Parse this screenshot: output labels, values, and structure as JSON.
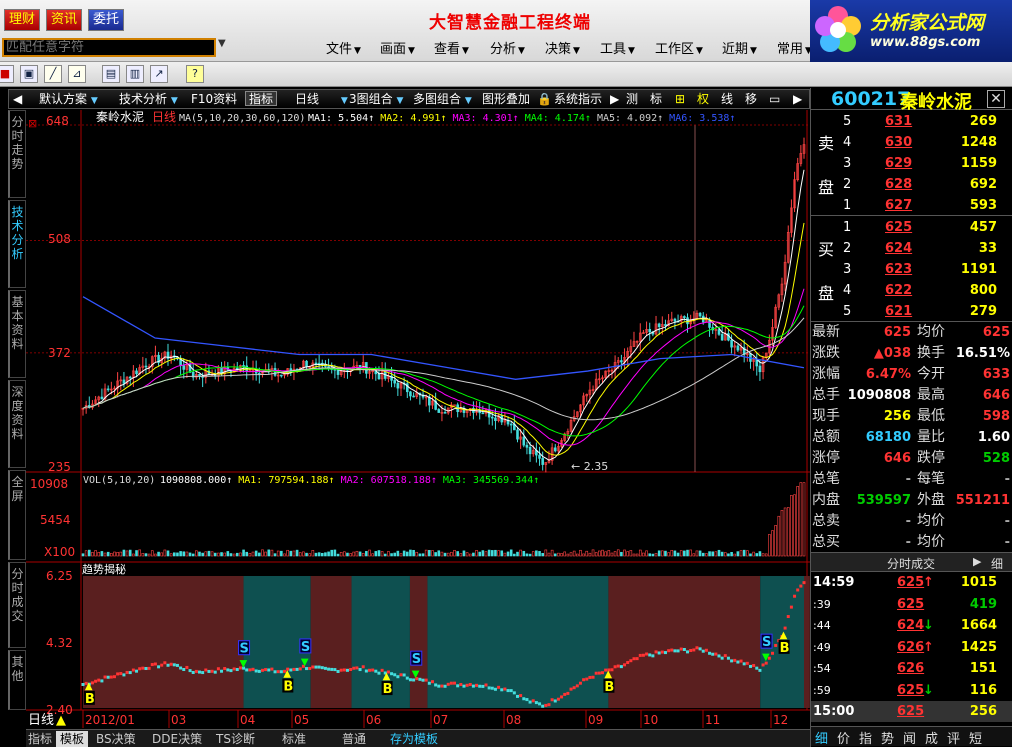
{
  "top": {
    "buttons": [
      "理财",
      "资讯",
      "委托"
    ],
    "title": "大智慧金融工程终端",
    "search_placeholder": "匹配任意字符",
    "menus": [
      "文件",
      "画面",
      "查看",
      "分析",
      "决策",
      "工具",
      "工作区",
      "近期",
      "常用"
    ],
    "logo_text": "分析家公式网",
    "logo_url": "www.88gs.com"
  },
  "toolbar": {
    "items": [
      "默认方案",
      "技术分析",
      "F10资料",
      "指标",
      "日线",
      "3图组合",
      "多图组合",
      "图形叠加",
      "系统指示",
      "测",
      "标",
      "权",
      "线",
      "移"
    ]
  },
  "lefttabs": [
    "分时走势",
    "技术分析",
    "基本资料",
    "深度资料",
    "全屏",
    "分时成交",
    "其他"
  ],
  "chart": {
    "stock_name": "秦岭水泥",
    "period": "日线",
    "ma_label": "MA(5,10,20,30,60,120)",
    "ma_values": [
      {
        "name": "MA1",
        "value": "5.504",
        "color": "#ffffff"
      },
      {
        "name": "MA2",
        "value": "4.991",
        "color": "#ffff00"
      },
      {
        "name": "MA3",
        "value": "4.301",
        "color": "#ff00ff"
      },
      {
        "name": "MA4",
        "value": "4.174",
        "color": "#00ff00"
      },
      {
        "name": "MA5",
        "value": "4.092",
        "color": "#cccccc"
      },
      {
        "name": "MA6",
        "value": "3.538",
        "color": "#3355ff"
      }
    ],
    "price_ticks": [
      "648",
      "508",
      "372",
      "235"
    ],
    "low_label": "2.35",
    "vol_label": "VOL(5,10,20)",
    "vol_values": [
      {
        "name": "",
        "value": "1090808.000",
        "color": "#ffffff"
      },
      {
        "name": "MA1",
        "value": "797594.188",
        "color": "#ffff00"
      },
      {
        "name": "MA2",
        "value": "607518.188",
        "color": "#ff00ff"
      },
      {
        "name": "MA3",
        "value": "345569.344",
        "color": "#00ff00"
      }
    ],
    "vol_ticks": [
      "10908",
      "5454",
      "X100"
    ],
    "trend_label": "趋势揭秘",
    "trend_ticks": [
      "6.25",
      "4.32",
      "2.40"
    ],
    "buy_mark": "B",
    "sell_mark": "S",
    "date_labels": [
      "2012/01",
      "03",
      "04",
      "05",
      "06",
      "07",
      "08",
      "09",
      "10",
      "11",
      "12"
    ]
  },
  "chart_data": {
    "type": "line",
    "title": "",
    "xlabel": "",
    "ylabel": "",
    "x": [
      "2012/01",
      "03",
      "04",
      "05",
      "06",
      "07",
      "08",
      "09",
      "10",
      "11",
      "12"
    ],
    "ylim": [
      2.35,
      6.48
    ],
    "series": [
      {
        "name": "MA1",
        "values": [
          3.15,
          3.55,
          3.6,
          3.6,
          3.45,
          3.15,
          2.55,
          3.4,
          4.1,
          3.9,
          5.5
        ]
      },
      {
        "name": "MA6",
        "values": [
          4.4,
          3.9,
          3.8,
          3.7,
          3.7,
          3.55,
          3.4,
          3.5,
          3.65,
          3.7,
          3.54
        ]
      }
    ],
    "volume_ylim": [
      0,
      10908
    ]
  },
  "quote": {
    "code": "600217",
    "name": "秦岭水泥",
    "sell_label": [
      "卖",
      "盘"
    ],
    "buy_label": [
      "买",
      "盘"
    ],
    "sell": [
      {
        "level": "5",
        "price": "631",
        "vol": "269"
      },
      {
        "level": "4",
        "price": "630",
        "vol": "1248"
      },
      {
        "level": "3",
        "price": "629",
        "vol": "1159"
      },
      {
        "level": "2",
        "price": "628",
        "vol": "692"
      },
      {
        "level": "1",
        "price": "627",
        "vol": "593"
      }
    ],
    "buy": [
      {
        "level": "1",
        "price": "625",
        "vol": "457"
      },
      {
        "level": "2",
        "price": "624",
        "vol": "33"
      },
      {
        "level": "3",
        "price": "623",
        "vol": "1191"
      },
      {
        "level": "4",
        "price": "622",
        "vol": "800"
      },
      {
        "level": "5",
        "price": "621",
        "vol": "279"
      }
    ],
    "stats": [
      {
        "l1": "最新",
        "v1": "625",
        "c1": "red",
        "l2": "均价",
        "v2": "625",
        "c2": "red"
      },
      {
        "l1": "涨跌",
        "v1": "▲038",
        "c1": "red",
        "l2": "换手",
        "v2": "16.51%",
        "c2": "wht"
      },
      {
        "l1": "涨幅",
        "v1": "6.47%",
        "c1": "red",
        "l2": "今开",
        "v2": "633",
        "c2": "red"
      },
      {
        "l1": "总手",
        "v1": "1090808",
        "c1": "wht",
        "l2": "最高",
        "v2": "646",
        "c2": "red"
      },
      {
        "l1": "现手",
        "v1": "256",
        "c1": "yel",
        "l2": "最低",
        "v2": "598",
        "c2": "red"
      },
      {
        "l1": "总额",
        "v1": "68180",
        "c1": "cy",
        "l2": "量比",
        "v2": "1.60",
        "c2": "wht"
      },
      {
        "l1": "涨停",
        "v1": "646",
        "c1": "red",
        "l2": "跌停",
        "v2": "528",
        "c2": "grn"
      },
      {
        "l1": "总笔",
        "v1": "-",
        "c1": "gry",
        "l2": "每笔",
        "v2": "-",
        "c2": "gry"
      },
      {
        "l1": "内盘",
        "v1": "539597",
        "c1": "grn",
        "l2": "外盘",
        "v2": "551211",
        "c2": "red"
      },
      {
        "l1": "总卖",
        "v1": "-",
        "c1": "gry",
        "l2": "均价",
        "v2": "-",
        "c2": "gry"
      },
      {
        "l1": "总买",
        "v1": "-",
        "c1": "gry",
        "l2": "均价",
        "v2": "-",
        "c2": "gry"
      }
    ],
    "ticks_title": "分时成交",
    "ticks_btn": "细",
    "ticks": [
      {
        "time": "14:59",
        "price": "625",
        "arrow": "↑",
        "ac": "red",
        "vol": "1015",
        "vc": "yel"
      },
      {
        "time": ":39",
        "price": "625",
        "arrow": "",
        "ac": "red",
        "vol": "419",
        "vc": "grn"
      },
      {
        "time": ":44",
        "price": "624",
        "arrow": "↓",
        "ac": "grn",
        "vol": "1664",
        "vc": "yel"
      },
      {
        "time": ":49",
        "price": "626",
        "arrow": "↑",
        "ac": "red",
        "vol": "1425",
        "vc": "yel"
      },
      {
        "time": ":54",
        "price": "626",
        "arrow": "",
        "ac": "red",
        "vol": "151",
        "vc": "yel"
      },
      {
        "time": ":59",
        "price": "625",
        "arrow": "↓",
        "ac": "grn",
        "vol": "116",
        "vc": "yel"
      },
      {
        "time": "15:00",
        "price": "625",
        "arrow": "",
        "ac": "red",
        "vol": "256",
        "vc": "yel"
      }
    ],
    "bottom_tabs": [
      "细",
      "价",
      "指",
      "势",
      "闻",
      "成",
      "评",
      "短"
    ]
  },
  "status": {
    "day": "日线",
    "tabs": [
      "指标",
      "模板",
      "BS决策",
      "DDE决策",
      "TS诊断",
      "标准",
      "普通",
      "存为模板"
    ]
  }
}
